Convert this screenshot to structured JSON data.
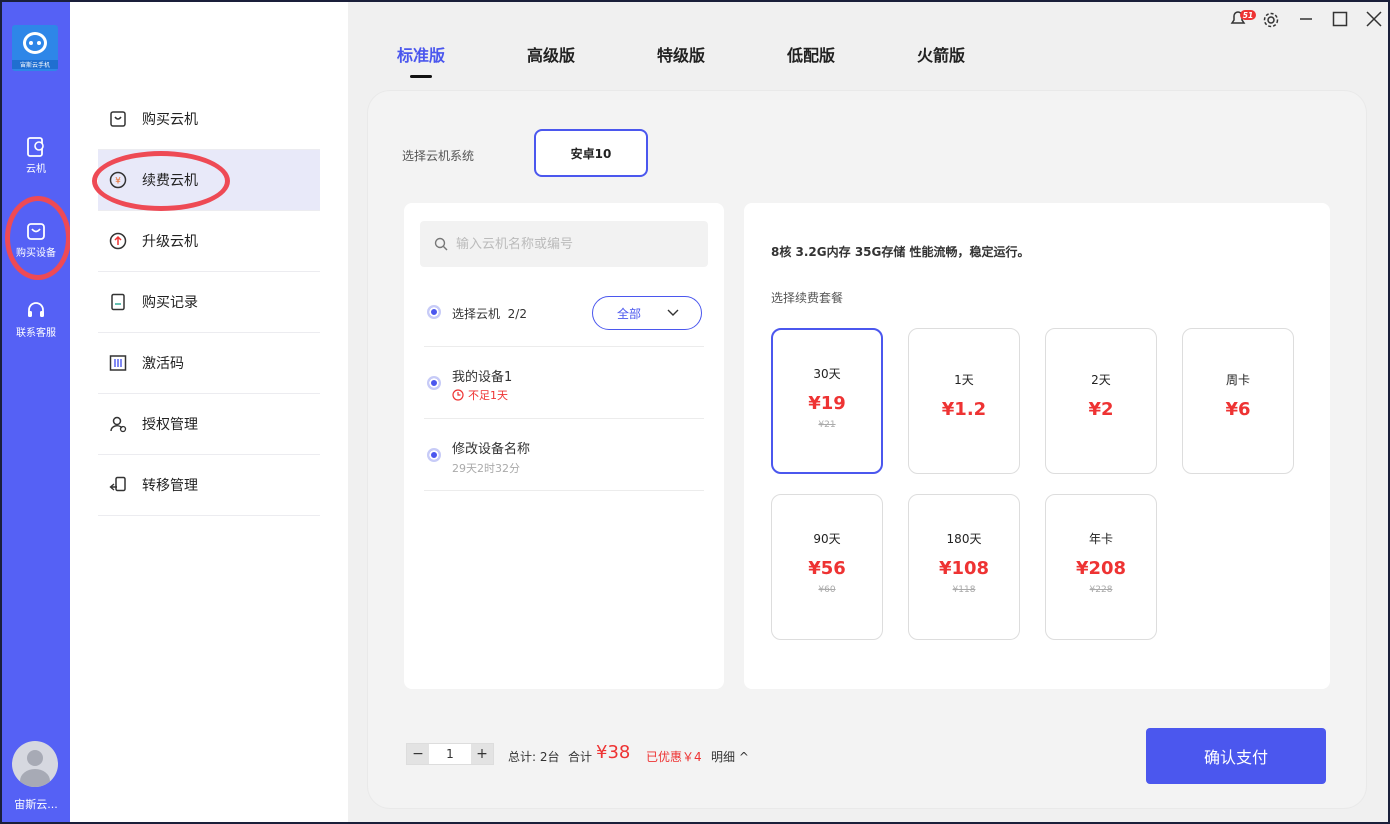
{
  "app": {
    "logo_text": "宙斯云手机"
  },
  "rail": {
    "items": [
      {
        "label": "云机"
      },
      {
        "label": "购买设备"
      },
      {
        "label": "联系客服"
      }
    ],
    "user": "宙斯云..."
  },
  "submenu": {
    "items": [
      {
        "label": "购买云机"
      },
      {
        "label": "续费云机"
      },
      {
        "label": "升级云机"
      },
      {
        "label": "购买记录"
      },
      {
        "label": "激活码"
      },
      {
        "label": "授权管理"
      },
      {
        "label": "转移管理"
      }
    ]
  },
  "tabs": [
    {
      "label": "标准版"
    },
    {
      "label": "高级版"
    },
    {
      "label": "特级版"
    },
    {
      "label": "低配版"
    },
    {
      "label": "火箭版"
    }
  ],
  "window": {
    "notify_badge": "51"
  },
  "system": {
    "label": "选择云机系统",
    "option": "安卓10"
  },
  "devices": {
    "search_placeholder": "输入云机名称或编号",
    "select_label": "选择云机",
    "select_count": "2/2",
    "filter": "全部",
    "list": [
      {
        "name": "我的设备1",
        "status": "不足1天"
      },
      {
        "name": "修改设备名称",
        "status": "29天2时32分"
      }
    ]
  },
  "plans": {
    "spec": "8核 3.2G内存 35G存储 性能流畅，稳定运行。",
    "label": "选择续费套餐",
    "items": [
      {
        "name": "30天",
        "price": "¥19",
        "original": "¥21"
      },
      {
        "name": "1天",
        "price": "¥1.2",
        "original": ""
      },
      {
        "name": "2天",
        "price": "¥2",
        "original": ""
      },
      {
        "name": "周卡",
        "price": "¥6",
        "original": ""
      },
      {
        "name": "90天",
        "price": "¥56",
        "original": "¥60"
      },
      {
        "name": "180天",
        "price": "¥108",
        "original": "¥118"
      },
      {
        "name": "年卡",
        "price": "¥208",
        "original": "¥228"
      }
    ]
  },
  "footer": {
    "minus": "−",
    "quantity": "1",
    "plus": "+",
    "total_count": "总计: 2台",
    "sum_label": "合计",
    "sum_value": "¥38",
    "discount": "已优惠￥4",
    "detail": "明细 ^",
    "pay": "确认支付"
  },
  "colors": {
    "accent": "#4b57ee",
    "rail": "#5561f5",
    "price": "#e33333",
    "ring": "#ee4a55"
  }
}
